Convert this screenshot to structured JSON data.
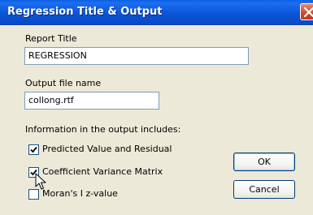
{
  "window": {
    "title": "Regression Title & Output"
  },
  "report_title": {
    "label": "Report Title",
    "value": "REGRESSION"
  },
  "output_file": {
    "label": "Output file name",
    "value": "collong.rtf"
  },
  "output_info": {
    "label": "Information in the output includes:",
    "options": [
      {
        "label": "Predicted Value and Residual",
        "checked": true
      },
      {
        "label": "Coefficient Variance Matrix",
        "checked": true
      },
      {
        "label": "Moran's I  z-value",
        "checked": false
      }
    ]
  },
  "buttons": {
    "ok": "OK",
    "cancel": "Cancel"
  },
  "icons": {
    "close": "close-icon",
    "check": "checkmark-icon",
    "cursor": "mouse-pointer-icon"
  },
  "colors": {
    "titlebar": "#0a55d8",
    "close": "#d5452b",
    "dialog_bg": "#ece9d8"
  }
}
